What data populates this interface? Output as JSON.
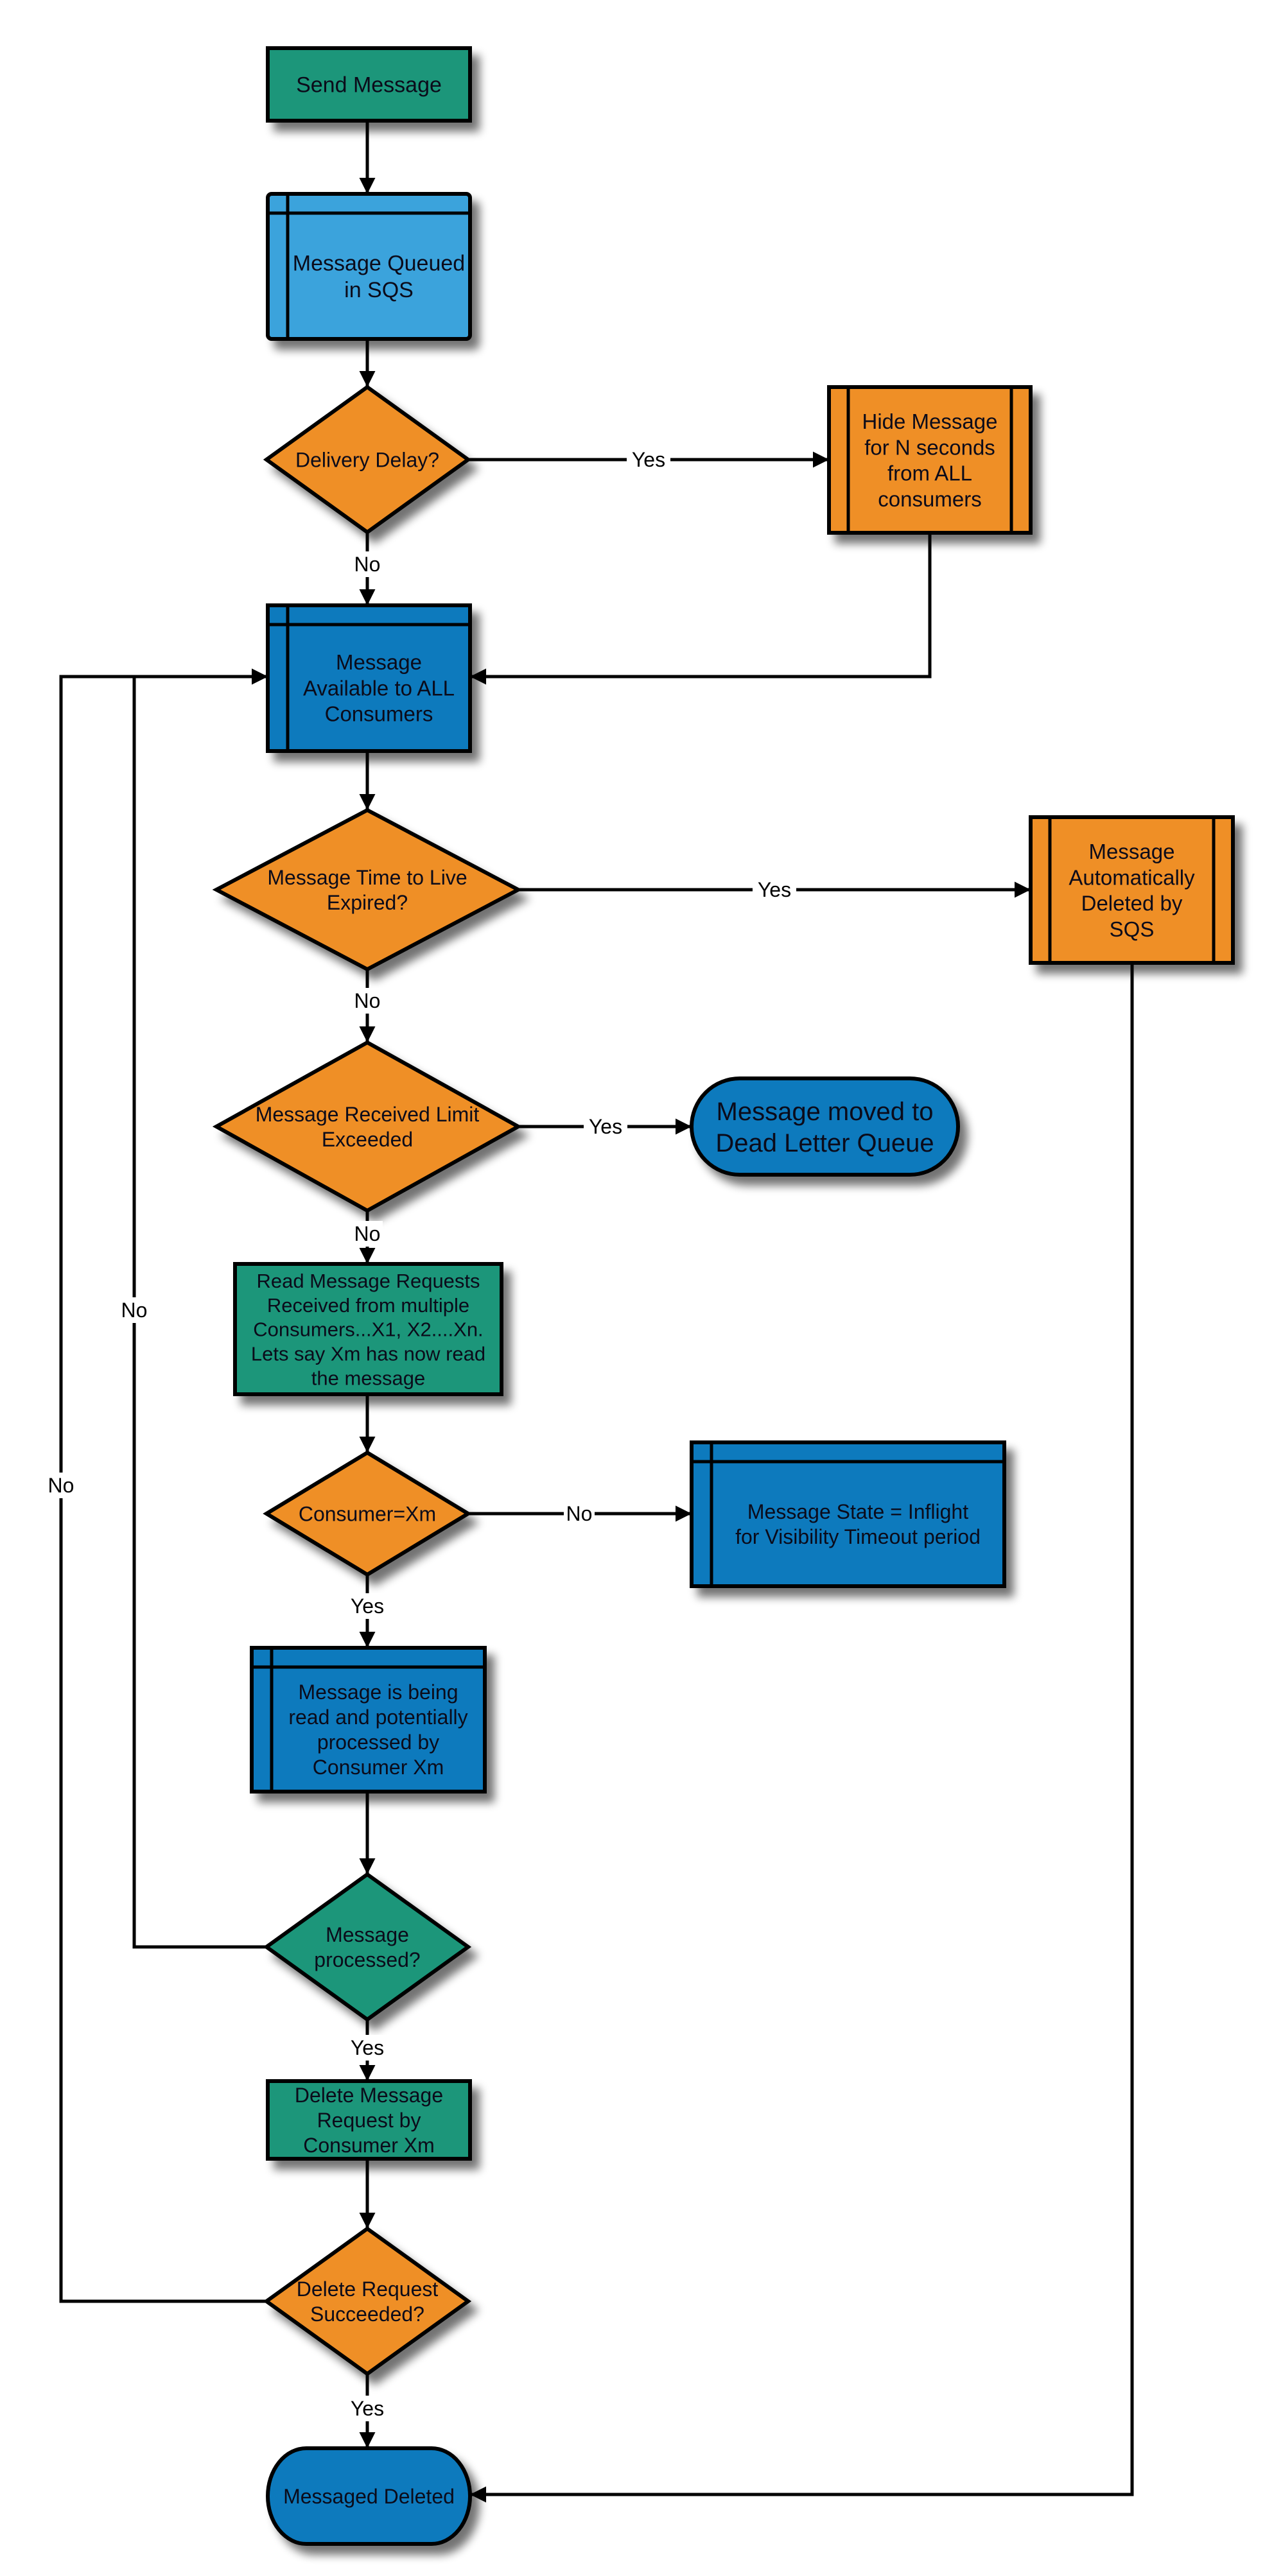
{
  "diagram": {
    "type": "flowchart",
    "colors": {
      "green": "#1b967a",
      "light_blue": "#3ba3dc",
      "blue": "#0f7abd",
      "orange": "#ef8f25",
      "line": "#000000"
    },
    "nodes": {
      "send_message": {
        "label": [
          "Send Message"
        ],
        "shape": "process",
        "color": "green"
      },
      "message_queued": {
        "label": [
          "Message Queued",
          "in SQS"
        ],
        "shape": "internal-storage",
        "color": "light_blue"
      },
      "delivery_delay": {
        "label": [
          "Delivery Delay?"
        ],
        "shape": "decision",
        "color": "orange"
      },
      "hide_message": {
        "label": [
          "Hide Message",
          "for N seconds",
          "from ALL",
          "consumers"
        ],
        "shape": "predefined-process",
        "color": "orange"
      },
      "message_available": {
        "label": [
          "Message",
          "Available to ALL",
          "Consumers"
        ],
        "shape": "internal-storage",
        "color": "blue"
      },
      "ttl_expired": {
        "label": [
          "Message Time to Live",
          "Expired?"
        ],
        "shape": "decision",
        "color": "orange"
      },
      "auto_deleted": {
        "label": [
          "Message",
          "Automatically",
          "Deleted by",
          "SQS"
        ],
        "shape": "predefined-process",
        "color": "orange"
      },
      "receive_limit": {
        "label": [
          "Message Received Limit",
          "Exceeded"
        ],
        "shape": "decision",
        "color": "orange"
      },
      "dead_letter": {
        "label": [
          "Message moved to",
          "Dead Letter Queue"
        ],
        "shape": "terminator",
        "color": "blue"
      },
      "read_requests": {
        "label": [
          "Read Message Requests",
          "Received from multiple",
          "Consumers...X1, X2....Xn.",
          "Lets say Xm has now read",
          "the message"
        ],
        "shape": "process",
        "color": "green"
      },
      "consumer_check": {
        "label": [
          "Consumer=Xm"
        ],
        "shape": "decision",
        "color": "orange"
      },
      "inflight": {
        "label": [
          "Message State = Inflight",
          "for Visibility Timeout period"
        ],
        "shape": "internal-storage",
        "color": "blue"
      },
      "being_processed": {
        "label": [
          "Message is being",
          "read and potentially",
          "processed by",
          "Consumer Xm"
        ],
        "shape": "internal-storage",
        "color": "blue"
      },
      "processed_check": {
        "label": [
          "Message",
          "processed?"
        ],
        "shape": "decision",
        "color": "green"
      },
      "delete_request": {
        "label": [
          "Delete Message",
          "Request by",
          "Consumer Xm"
        ],
        "shape": "process",
        "color": "green"
      },
      "delete_succeeded": {
        "label": [
          "Delete Request",
          "Succeeded?"
        ],
        "shape": "decision",
        "color": "orange"
      },
      "message_deleted": {
        "label": [
          "Messaged Deleted"
        ],
        "shape": "terminator",
        "color": "blue"
      }
    },
    "edges": [
      {
        "from": "send_message",
        "to": "message_queued",
        "label": ""
      },
      {
        "from": "message_queued",
        "to": "delivery_delay",
        "label": ""
      },
      {
        "from": "delivery_delay",
        "to": "hide_message",
        "label": "Yes"
      },
      {
        "from": "delivery_delay",
        "to": "message_available",
        "label": "No"
      },
      {
        "from": "hide_message",
        "to": "message_available",
        "label": ""
      },
      {
        "from": "message_available",
        "to": "ttl_expired",
        "label": ""
      },
      {
        "from": "ttl_expired",
        "to": "auto_deleted",
        "label": "Yes"
      },
      {
        "from": "ttl_expired",
        "to": "receive_limit",
        "label": "No"
      },
      {
        "from": "receive_limit",
        "to": "dead_letter",
        "label": "Yes"
      },
      {
        "from": "receive_limit",
        "to": "read_requests",
        "label": "No"
      },
      {
        "from": "read_requests",
        "to": "consumer_check",
        "label": ""
      },
      {
        "from": "consumer_check",
        "to": "inflight",
        "label": "No"
      },
      {
        "from": "consumer_check",
        "to": "being_processed",
        "label": "Yes"
      },
      {
        "from": "being_processed",
        "to": "processed_check",
        "label": ""
      },
      {
        "from": "processed_check",
        "to": "message_available",
        "label": "No"
      },
      {
        "from": "processed_check",
        "to": "delete_request",
        "label": "Yes"
      },
      {
        "from": "delete_request",
        "to": "delete_succeeded",
        "label": ""
      },
      {
        "from": "delete_succeeded",
        "to": "message_available",
        "label": "No"
      },
      {
        "from": "delete_succeeded",
        "to": "message_deleted",
        "label": "Yes"
      },
      {
        "from": "auto_deleted",
        "to": "message_deleted",
        "label": ""
      }
    ]
  }
}
